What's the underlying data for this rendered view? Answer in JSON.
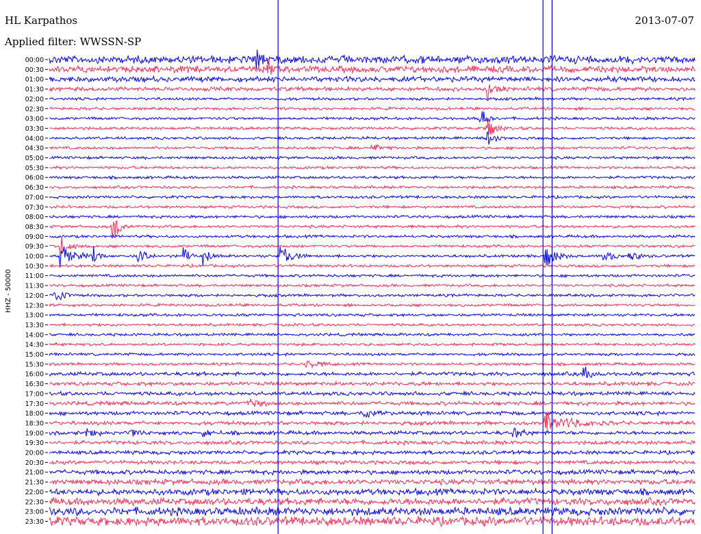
{
  "header": {
    "station": "HL Karpathos",
    "date": "2013-07-07",
    "filter": "Applied filter: WWSSN-SP"
  },
  "chart_data": {
    "type": "line",
    "title": "HL Karpathos",
    "ylabel": "HHZ - 50000",
    "row_labels": [
      "00:00",
      "00:30",
      "01:00",
      "01:30",
      "02:00",
      "02:30",
      "03:00",
      "03:30",
      "04:00",
      "04:30",
      "05:00",
      "05:30",
      "06:00",
      "06:30",
      "07:00",
      "07:30",
      "08:00",
      "08:30",
      "09:00",
      "09:30",
      "10:00",
      "10:30",
      "11:00",
      "11:30",
      "12:00",
      "12:30",
      "13:00",
      "13:30",
      "14:00",
      "14:30",
      "15:00",
      "15:30",
      "16:00",
      "16:30",
      "17:00",
      "17:30",
      "18:00",
      "18:30",
      "19:00",
      "19:30",
      "20:00",
      "20:30",
      "21:00",
      "21:30",
      "22:00",
      "22:30",
      "23:00",
      "23:30"
    ],
    "trace_colors": [
      "#0000ff",
      "#ff2a50"
    ],
    "events": [
      {
        "row": 0,
        "x": 0.32,
        "amp": 3,
        "dur": 0.03
      },
      {
        "row": 1,
        "x": 0.34,
        "amp": 2.5,
        "dur": 0.02
      },
      {
        "row": 3,
        "x": 0.68,
        "amp": 2.5,
        "dur": 0.03
      },
      {
        "row": 6,
        "x": 0.67,
        "amp": 3,
        "dur": 0.03
      },
      {
        "row": 7,
        "x": 0.68,
        "amp": 3,
        "dur": 0.03
      },
      {
        "row": 8,
        "x": 0.68,
        "amp": 2.5,
        "dur": 0.03
      },
      {
        "row": 9,
        "x": 0.5,
        "amp": 1.2,
        "dur": 0.04
      },
      {
        "row": 17,
        "x": 0.1,
        "amp": 2,
        "dur": 0.02
      },
      {
        "row": 17,
        "x": 0.1,
        "amp": 2.5,
        "dur": 0.03
      },
      {
        "row": 19,
        "x": 0.02,
        "amp": 2.5,
        "dur": 0.04
      },
      {
        "row": 20,
        "x": 0.02,
        "amp": 3.2,
        "dur": 0.05
      },
      {
        "row": 20,
        "x": 0.07,
        "amp": 2.5,
        "dur": 0.02
      },
      {
        "row": 20,
        "x": 0.14,
        "amp": 2.5,
        "dur": 0.03
      },
      {
        "row": 20,
        "x": 0.21,
        "amp": 2.2,
        "dur": 0.02
      },
      {
        "row": 20,
        "x": 0.24,
        "amp": 3,
        "dur": 0.03
      },
      {
        "row": 20,
        "x": 0.36,
        "amp": 3.5,
        "dur": 0.04
      },
      {
        "row": 20,
        "x": 0.77,
        "amp": 3.5,
        "dur": 0.04
      },
      {
        "row": 20,
        "x": 0.86,
        "amp": 2.2,
        "dur": 0.03
      },
      {
        "row": 20,
        "x": 0.9,
        "amp": 1.8,
        "dur": 0.03
      },
      {
        "row": 24,
        "x": 0.01,
        "amp": 2.5,
        "dur": 0.03
      },
      {
        "row": 31,
        "x": 0.4,
        "amp": 1.5,
        "dur": 0.04
      },
      {
        "row": 32,
        "x": 0.83,
        "amp": 2.2,
        "dur": 0.03
      },
      {
        "row": 35,
        "x": 0.31,
        "amp": 1.5,
        "dur": 0.03
      },
      {
        "row": 36,
        "x": 0.49,
        "amp": 1.5,
        "dur": 0.03
      },
      {
        "row": 37,
        "x": 0.77,
        "amp": 3,
        "dur": 0.1
      },
      {
        "row": 38,
        "x": 0.06,
        "amp": 1.5,
        "dur": 0.03
      },
      {
        "row": 38,
        "x": 0.13,
        "amp": 1.5,
        "dur": 0.03
      },
      {
        "row": 38,
        "x": 0.24,
        "amp": 1.3,
        "dur": 0.03
      },
      {
        "row": 38,
        "x": 0.72,
        "amp": 1.8,
        "dur": 0.03
      }
    ],
    "vertical_spikes": [
      {
        "x": 0.354,
        "top_row": 0,
        "bottom_row": 47
      },
      {
        "x": 0.764,
        "top_row": 0,
        "bottom_row": 47
      },
      {
        "x": 0.778,
        "top_row": 0,
        "bottom_row": 47
      }
    ]
  }
}
